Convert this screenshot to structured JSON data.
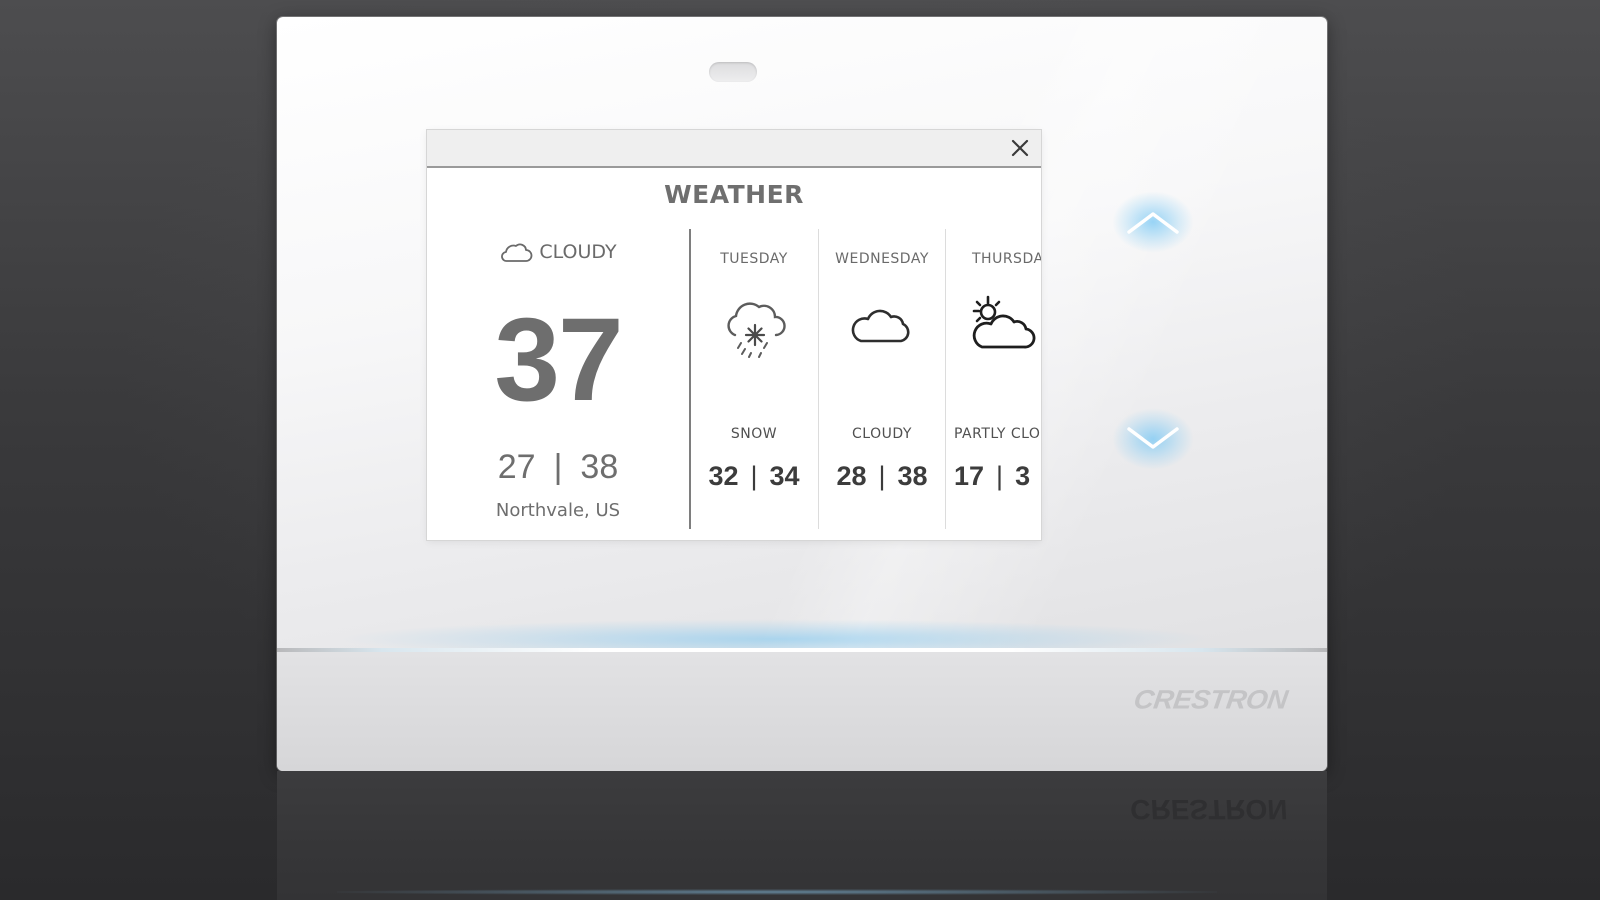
{
  "device": {
    "brand": "CRESTRON",
    "accent_color": "#8fd0f2",
    "buttons": {
      "up_label": "up",
      "down_label": "down"
    }
  },
  "screen": {
    "title": "WEATHER",
    "close_icon": "close-icon",
    "current": {
      "condition": "CLOUDY",
      "icon": "cloud-icon",
      "temperature": "37",
      "low": "27",
      "high": "38",
      "separator": "|",
      "location": "Northvale, US"
    },
    "forecast": [
      {
        "day": "TUESDAY",
        "condition": "SNOW",
        "icon": "snow-icon",
        "low": "32",
        "high": "34",
        "separator": "|"
      },
      {
        "day": "WEDNESDAY",
        "condition": "CLOUDY",
        "icon": "cloud-icon",
        "low": "28",
        "high": "38",
        "separator": "|"
      },
      {
        "day": "THURSDA",
        "condition": "PARTLY CLO",
        "icon": "partly-cloudy-icon",
        "low": "17",
        "high": "3",
        "separator": "|"
      }
    ]
  }
}
